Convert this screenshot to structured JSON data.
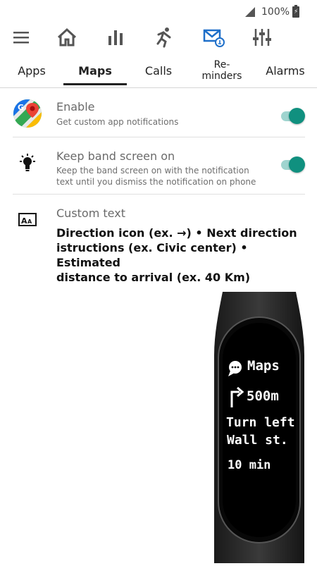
{
  "status": {
    "battery": "100%"
  },
  "tabs": [
    {
      "label": "Apps"
    },
    {
      "label": "Maps"
    },
    {
      "label": "Calls"
    },
    {
      "label_line1": "Re-",
      "label_line2": "minders"
    },
    {
      "label": "Alarms"
    }
  ],
  "active_tab": "Maps",
  "settings": {
    "enable": {
      "title": "Enable",
      "desc": "Get custom app notifications",
      "on": true
    },
    "keep_screen": {
      "title": "Keep band screen on",
      "desc_line1": "Keep the band screen on with the notification",
      "desc_line2": "text until you dismiss the notification on phone",
      "on": true
    },
    "custom_text": {
      "title": "Custom text",
      "line1": "Direction icon (ex. →) • Next direction",
      "line2": "istructions (ex. Civic center) • Estimated",
      "line3": "distance to arrival (ex. 40 Km)"
    }
  },
  "band_preview": {
    "app": "Maps",
    "distance": "500m",
    "line1": "Turn left",
    "line2": "Wall st.",
    "eta": "10 min"
  },
  "colors": {
    "accent": "#10907f",
    "track": "#9fd4cf",
    "nav_icon": "#555555",
    "active_icon": "#1e6fc9"
  },
  "icons": [
    "menu-icon",
    "home-icon",
    "bar-chart-icon",
    "running-icon",
    "mail-bell-icon",
    "sliders-icon",
    "google-maps-icon",
    "bulb-icon",
    "text-size-icon"
  ]
}
